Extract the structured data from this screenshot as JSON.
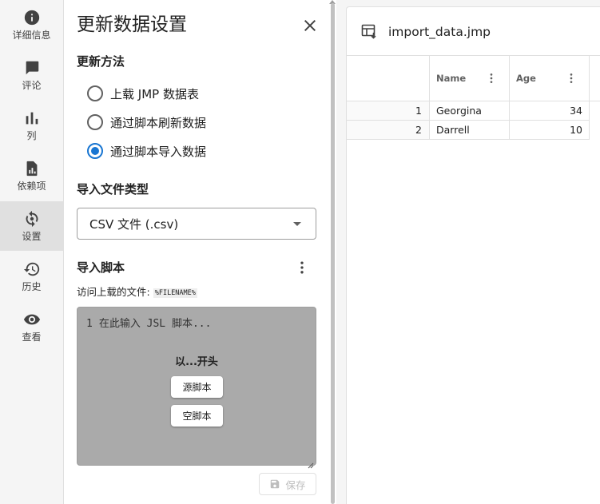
{
  "nav": {
    "items": [
      {
        "label": "详细信息",
        "icon": "info-icon"
      },
      {
        "label": "评论",
        "icon": "comment-icon"
      },
      {
        "label": "列",
        "icon": "columns-chart-icon"
      },
      {
        "label": "依赖项",
        "icon": "dependency-icon"
      },
      {
        "label": "设置",
        "icon": "settings-sync-icon",
        "active": true
      },
      {
        "label": "历史",
        "icon": "history-icon"
      },
      {
        "label": "查看",
        "icon": "eye-icon"
      }
    ]
  },
  "panel": {
    "title": "更新数据设置",
    "update_method": {
      "title": "更新方法",
      "options": [
        {
          "label": "上载 JMP 数据表",
          "checked": false
        },
        {
          "label": "通过脚本刷新数据",
          "checked": false
        },
        {
          "label": "通过脚本导入数据",
          "checked": true
        }
      ]
    },
    "file_type": {
      "title": "导入文件类型",
      "selected": "CSV 文件 (.csv)"
    },
    "import_script": {
      "title": "导入脚本",
      "helper": "访问上载的文件:",
      "helper_code": "%FILENAME%",
      "line_number": "1",
      "placeholder": "在此输入 JSL 脚本...",
      "start_with": "以...开头",
      "source_script_label": "源脚本",
      "empty_script_label": "空脚本"
    },
    "save_label": "保存"
  },
  "data_view": {
    "file_name": "import_data.jmp",
    "columns": [
      "Name",
      "Age"
    ],
    "rows": [
      {
        "num": "1",
        "name": "Georgina",
        "age": "34"
      },
      {
        "num": "2",
        "name": "Darrell",
        "age": "10"
      }
    ]
  },
  "colors": {
    "accent": "#1976d2",
    "editor_background": "#aaaaaa",
    "active_nav": "#e0e0e0"
  }
}
